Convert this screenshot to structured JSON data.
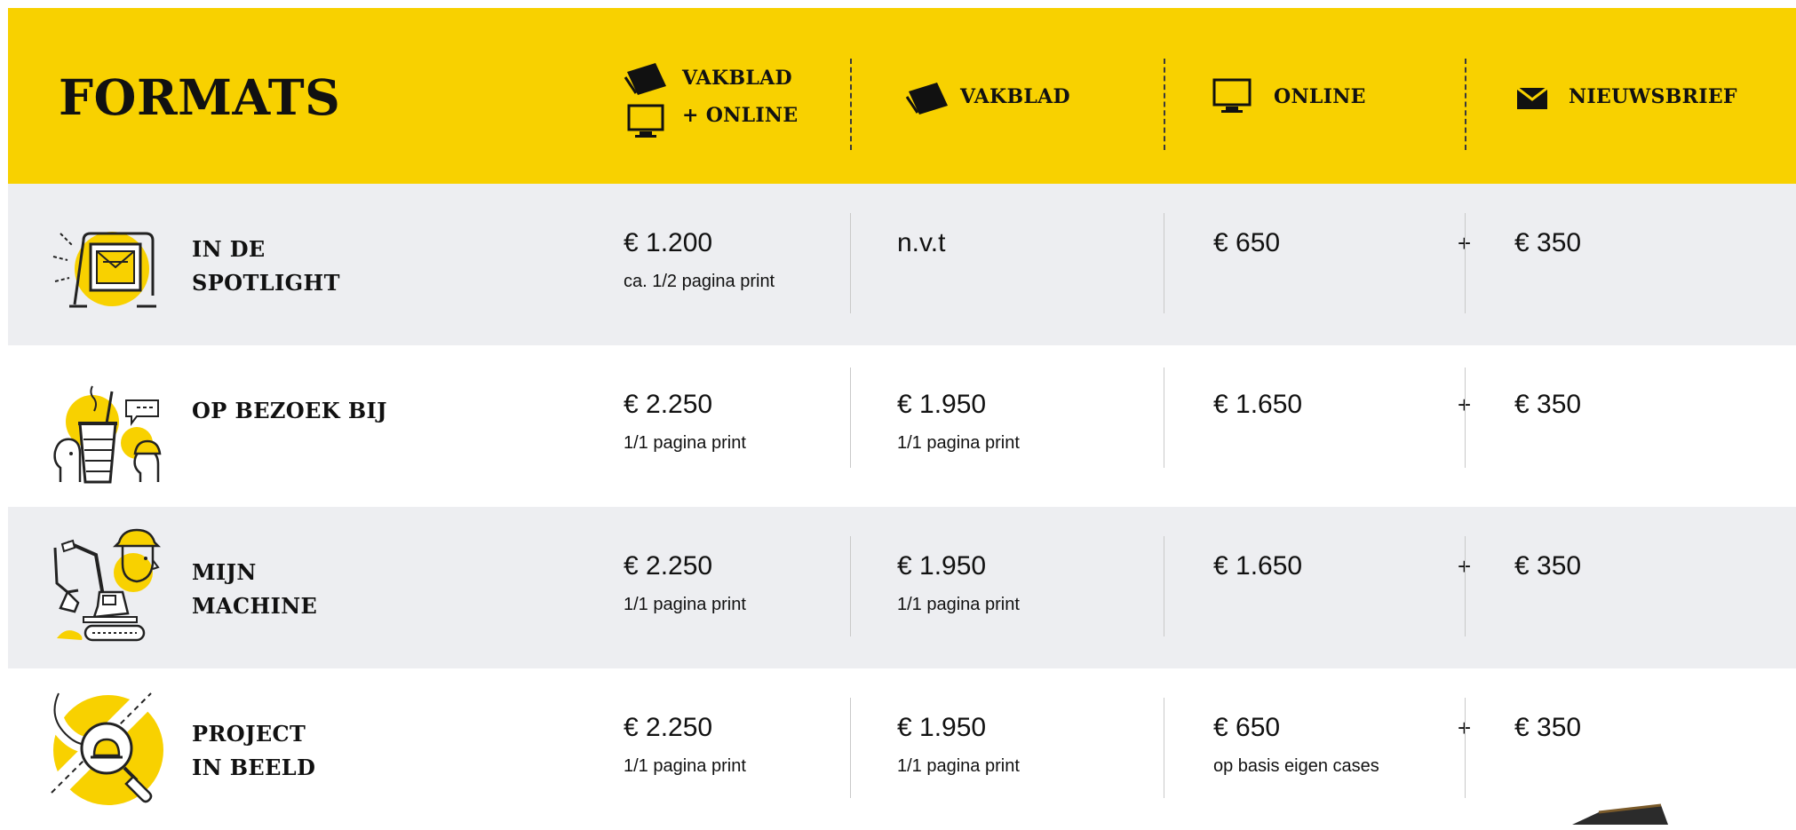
{
  "header": {
    "title": "FORMATS",
    "columns": [
      {
        "line1": "VAKBLAD",
        "line2": "+ ONLINE",
        "icons": [
          "magazine-icon",
          "monitor-icon"
        ]
      },
      {
        "label": "VAKBLAD",
        "icon": "magazine-icon"
      },
      {
        "label": "ONLINE",
        "icon": "monitor-icon"
      },
      {
        "label": "NIEUWSBRIEF",
        "icon": "envelope-icon"
      }
    ]
  },
  "rows": [
    {
      "name_line1": "IN DE",
      "name_line2": "SPOTLIGHT",
      "icon": "spotlight-newspaper-icon",
      "combo_price": "€ 1.200",
      "combo_sub": "ca. 1/2 pagina print",
      "vakblad_price": "n.v.t",
      "vakblad_sub": "",
      "online_price": "€ 650",
      "online_sub": "",
      "plus": "+",
      "newsletter_price": "€ 350"
    },
    {
      "name_line1": "OP BEZOEK BIJ",
      "name_line2": "",
      "icon": "coffee-conversation-icon",
      "combo_price": "€ 2.250",
      "combo_sub": "1/1 pagina print",
      "vakblad_price": "€ 1.950",
      "vakblad_sub": "1/1 pagina print",
      "online_price": "€ 1.650",
      "online_sub": "",
      "plus": "+",
      "newsletter_price": "€ 350"
    },
    {
      "name_line1": "MIJN",
      "name_line2": "MACHINE",
      "icon": "excavator-worker-icon",
      "combo_price": "€ 2.250",
      "combo_sub": "1/1 pagina print",
      "vakblad_price": "€ 1.950",
      "vakblad_sub": "1/1 pagina print",
      "online_price": "€ 1.650",
      "online_sub": "",
      "plus": "+",
      "newsletter_price": "€ 350"
    },
    {
      "name_line1": "PROJECT",
      "name_line2": "IN BEELD",
      "icon": "road-magnifier-icon",
      "combo_price": "€ 2.250",
      "combo_sub": "1/1 pagina print",
      "vakblad_price": "€ 1.950",
      "vakblad_sub": "1/1 pagina print",
      "online_price": "€ 650",
      "online_sub": "op basis eigen cases",
      "plus": "+",
      "newsletter_price": "€ 350"
    }
  ],
  "colors": {
    "accent": "#F8D100",
    "row_grey": "#EDEEF1",
    "text": "#111111"
  }
}
